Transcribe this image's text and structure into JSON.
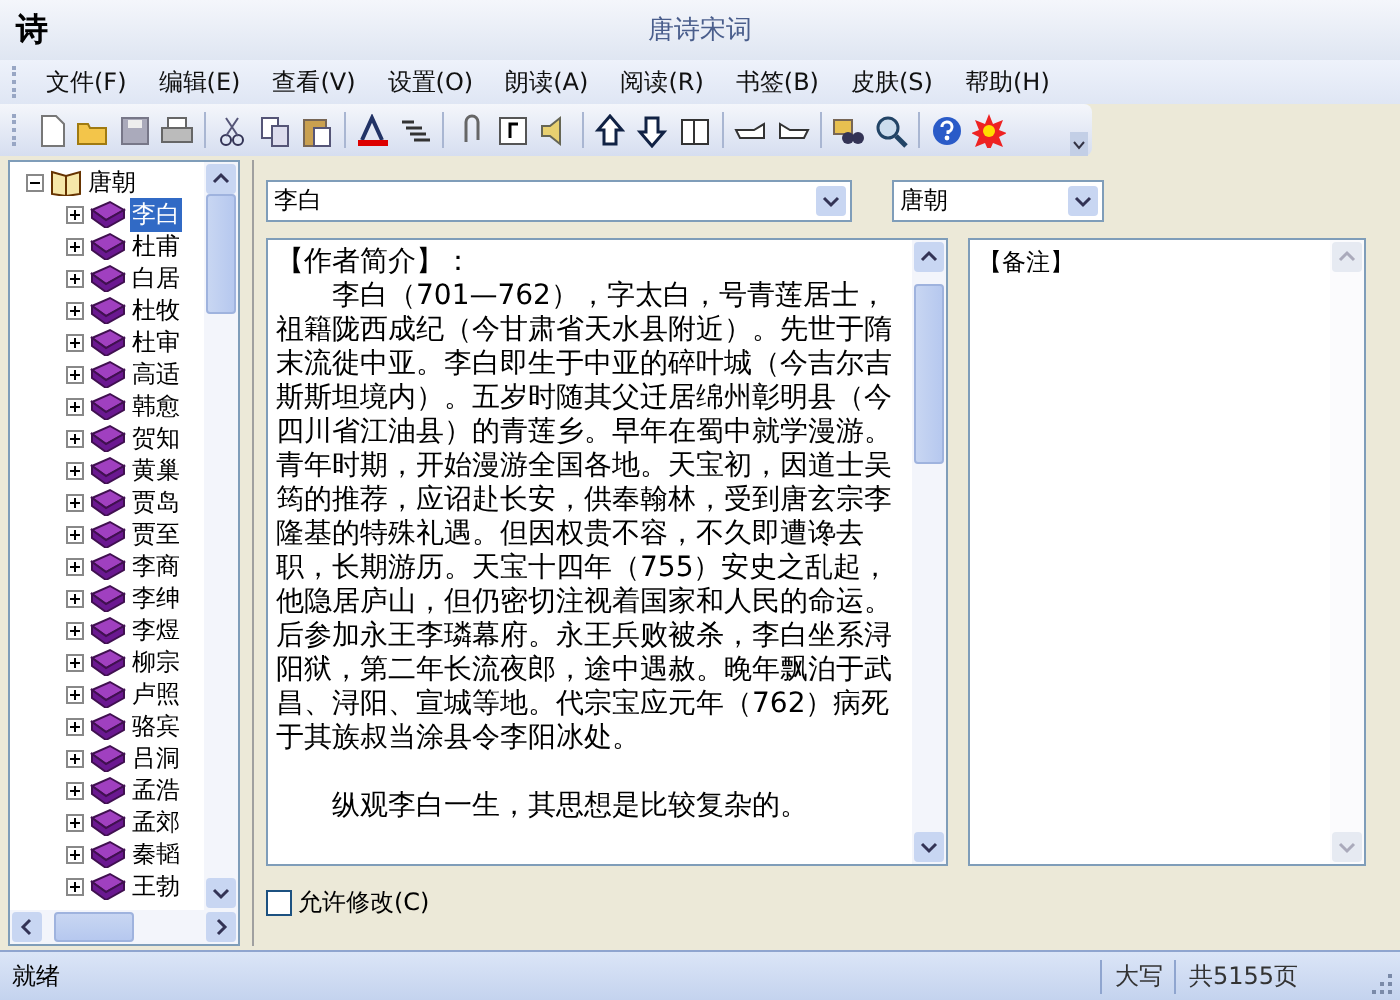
{
  "window": {
    "app_icon": "诗",
    "title": "唐诗宋词"
  },
  "menu": [
    "文件(F)",
    "编辑(E)",
    "查看(V)",
    "设置(O)",
    "朗读(A)",
    "阅读(R)",
    "书签(B)",
    "皮肤(S)",
    "帮助(H)"
  ],
  "tree": [
    {
      "label": "唐朝",
      "expanded": true,
      "selected": false,
      "children": [
        {
          "label": "李白",
          "selected": true
        },
        {
          "label": "杜甫",
          "selected": false
        },
        {
          "label": "白居",
          "selected": false
        },
        {
          "label": "杜牧",
          "selected": false
        },
        {
          "label": "杜审",
          "selected": false
        },
        {
          "label": "高适",
          "selected": false
        },
        {
          "label": "韩愈",
          "selected": false
        },
        {
          "label": "贺知",
          "selected": false
        },
        {
          "label": "黄巢",
          "selected": false
        },
        {
          "label": "贾岛",
          "selected": false
        },
        {
          "label": "贾至",
          "selected": false
        },
        {
          "label": "李商",
          "selected": false
        },
        {
          "label": "李绅",
          "selected": false
        },
        {
          "label": "李煜",
          "selected": false
        },
        {
          "label": "柳宗",
          "selected": false
        },
        {
          "label": "卢照",
          "selected": false
        },
        {
          "label": "骆宾",
          "selected": false
        },
        {
          "label": "吕洞",
          "selected": false
        },
        {
          "label": "孟浩",
          "selected": false
        },
        {
          "label": "孟郊",
          "selected": false
        },
        {
          "label": "秦韬",
          "selected": false
        },
        {
          "label": "王勃",
          "selected": false
        }
      ]
    }
  ],
  "author_select": {
    "value": "李白"
  },
  "dynasty_select": {
    "value": "唐朝"
  },
  "biography": {
    "heading": "【作者简介】：",
    "paragraphs": [
      "李白（701—762），字太白，号青莲居士，祖籍陇西成纪（今甘肃省天水县附近）。先世于隋末流徙中亚。李白即生于中亚的碎叶城（今吉尔吉斯斯坦境内）。五岁时随其父迁居绵州彰明县（今四川省江油县）的青莲乡。早年在蜀中就学漫游。青年时期，开始漫游全国各地。天宝初，因道士吴筠的推荐，应诏赴长安，供奉翰林，受到唐玄宗李隆基的特殊礼遇。但因权贵不容，不久即遭谗去职，长期游历。天宝十四年（755）安史之乱起，他隐居庐山，但仍密切注视着国家和人民的命运。后参加永王李璘幕府。永王兵败被杀，李白坐系浔阳狱，第二年长流夜郎，途中遇赦。晚年飘泊于武昌、浔阳、宣城等地。代宗宝应元年（762）病死于其族叔当涂县令李阳冰处。",
      "纵观李白一生，其思想是比较复杂的。"
    ]
  },
  "notes": {
    "heading": "【备注】"
  },
  "allow_edit": {
    "label": "允许修改(C)",
    "checked": false
  },
  "status_bar": {
    "message": "就绪",
    "caps": "大写",
    "pages": "共5155页"
  }
}
